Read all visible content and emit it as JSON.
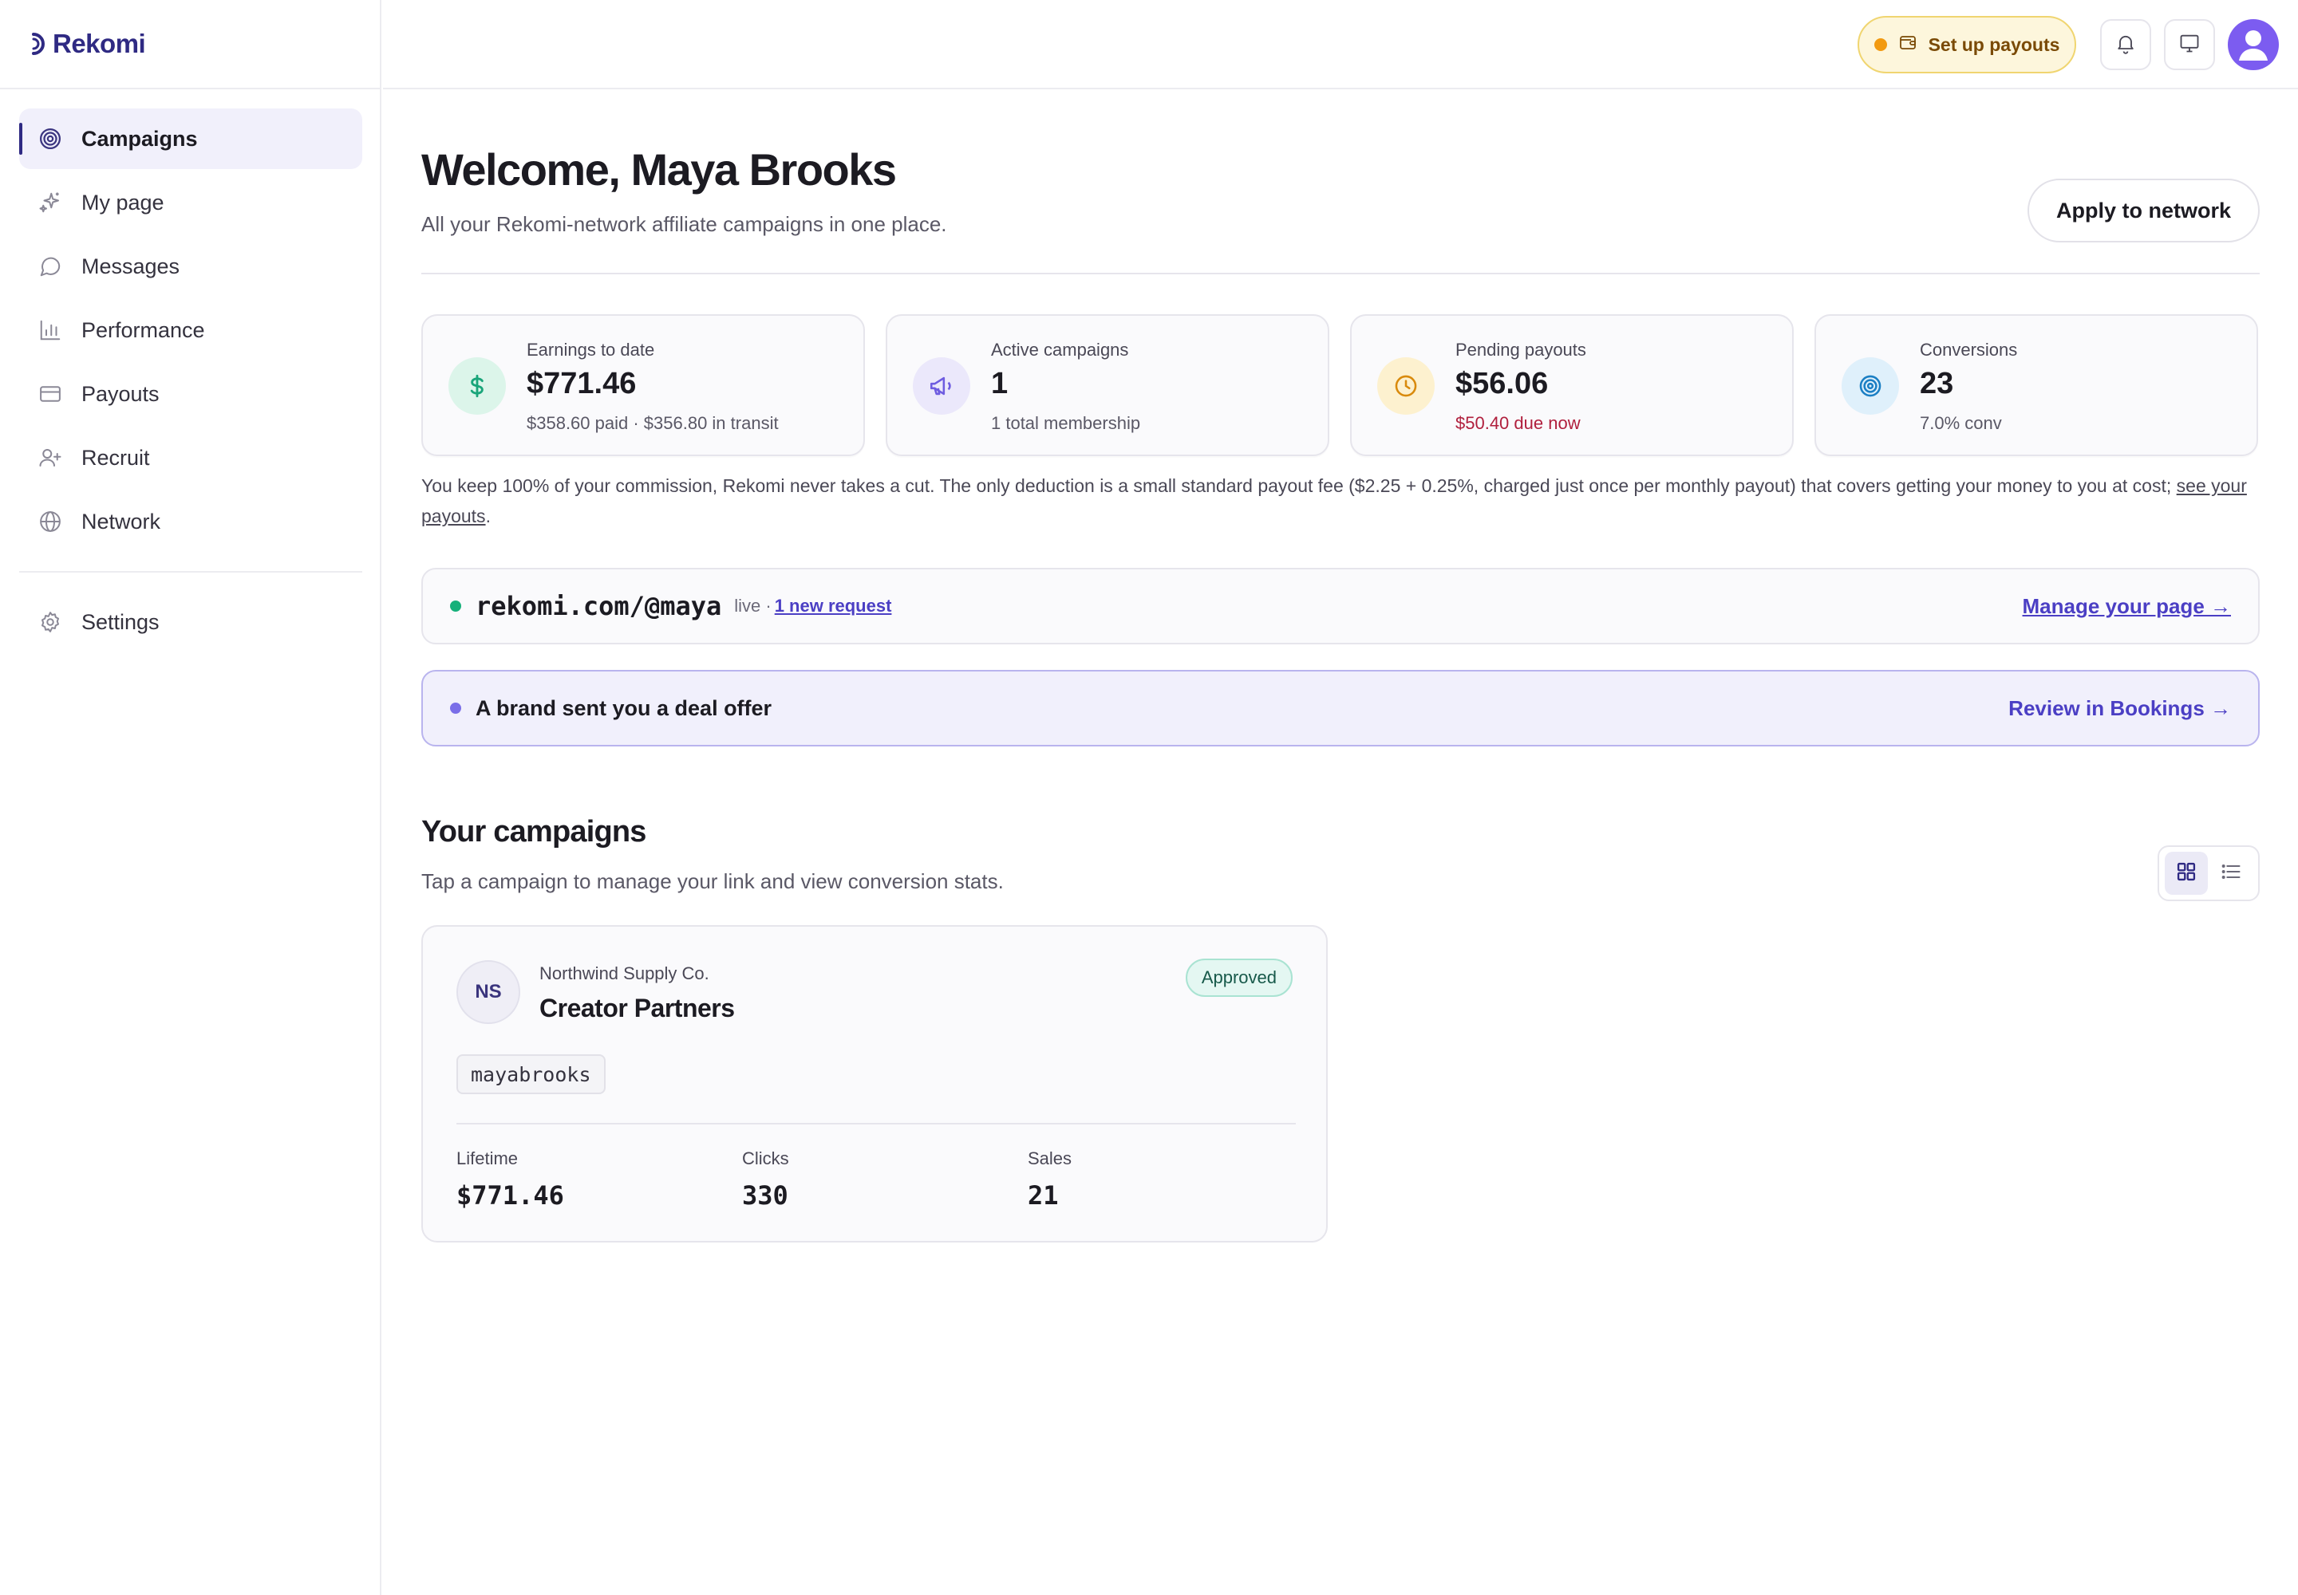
{
  "app": {
    "name": "Rekomi"
  },
  "sidebar": {
    "items": [
      {
        "label": "Campaigns",
        "icon": "target-icon"
      },
      {
        "label": "My page",
        "icon": "sparkles-icon"
      },
      {
        "label": "Messages",
        "icon": "chat-bubble-icon"
      },
      {
        "label": "Performance",
        "icon": "bar-chart-icon"
      },
      {
        "label": "Payouts",
        "icon": "credit-card-icon"
      },
      {
        "label": "Recruit",
        "icon": "user-plus-icon"
      },
      {
        "label": "Network",
        "icon": "globe-icon"
      }
    ],
    "footer_items": [
      {
        "label": "Settings",
        "icon": "gear-icon"
      }
    ]
  },
  "topbar": {
    "payout_label": "Set up payouts",
    "notification_icon": "bell-icon",
    "display_icon": "monitor-icon",
    "avatar_icon": "user-avatar-icon"
  },
  "header": {
    "title": "Welcome, Maya Brooks",
    "subtitle": "All your Rekomi-network affiliate campaigns in one place.",
    "apply_label": "Apply to network"
  },
  "stats": [
    {
      "label": "Earnings to date",
      "value": "$771.46",
      "sub": "$358.60 paid · $356.80 in transit",
      "icon": "dollar-icon",
      "color": "#1aa57a",
      "bg": "#dcf5ea"
    },
    {
      "label": "Active campaigns",
      "value": "1",
      "sub": "1 total membership",
      "icon": "megaphone-icon",
      "color": "#6e5ce0",
      "bg": "#ebe8fb"
    },
    {
      "label": "Pending payouts",
      "value": "$56.06",
      "sub": "$50.40 due now",
      "icon": "clock-icon",
      "color": "#d98a0c",
      "bg": "#fdf1cf"
    },
    {
      "label": "Conversions",
      "value": "23",
      "sub": "7.0% conv",
      "icon": "target-icon",
      "color": "#1b7fc4",
      "bg": "#dff0fb"
    }
  ],
  "note": {
    "text": "You keep 100% of your commission, Rekomi never takes a cut. The only deduction is a small standard payout fee ($2.25 + 0.25%, charged just once per monthly payout) that covers getting your money to you at cost; ",
    "link": "see your payouts",
    "end": "."
  },
  "page_banner": {
    "url": "rekomi.com/@maya",
    "status": "live ·",
    "request_link": "1 new request",
    "manage_link": "Manage your page →",
    "dot_color": "#16b07a"
  },
  "offer_banner": {
    "text": "A brand sent you a deal offer",
    "link": "Review in Bookings →",
    "dot_color": "#7a6ee8"
  },
  "campaigns_section": {
    "title": "Your campaigns",
    "subtitle": "Tap a campaign to manage your link and view conversion stats.",
    "view_options": [
      "grid-view-icon",
      "list-view-icon"
    ],
    "active_view": "grid"
  },
  "campaigns": [
    {
      "initials": "NS",
      "brand": "Northwind Supply Co.",
      "name": "Creator Partners",
      "status": "Approved",
      "code": "mayabrooks",
      "metrics": [
        {
          "label": "Lifetime",
          "value": "$771.46"
        },
        {
          "label": "Clicks",
          "value": "330"
        },
        {
          "label": "Sales",
          "value": "21"
        }
      ]
    }
  ]
}
